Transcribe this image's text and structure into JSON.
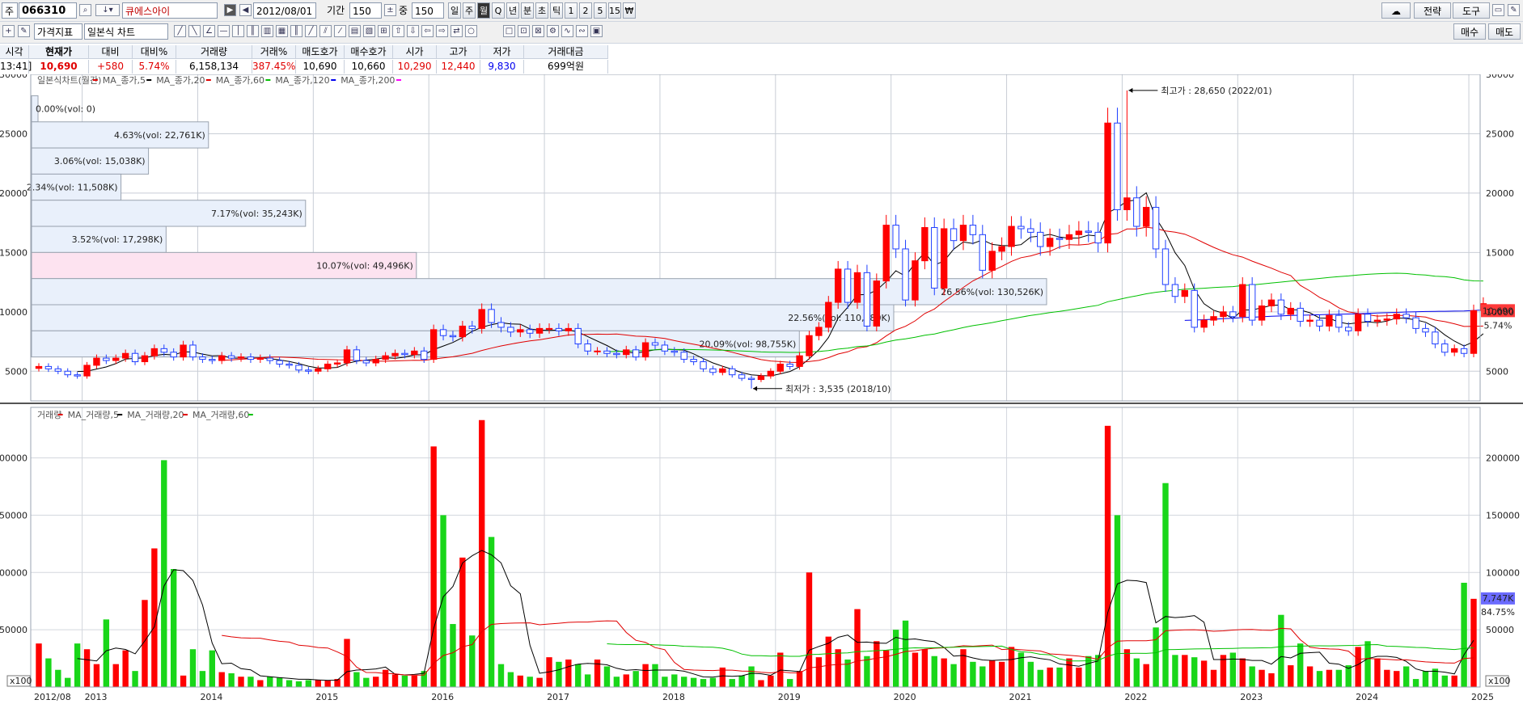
{
  "toolbar1": {
    "market_label": "주",
    "code": "066310",
    "name": "큐에스아이",
    "date": "2012/08/01",
    "period_label": "기간",
    "period_value": "150",
    "count_label": "중",
    "count_value": "150",
    "period_buttons": [
      "일",
      "주",
      "월",
      "Q",
      "년",
      "분",
      "초",
      "틱",
      "1",
      "2",
      "5",
      "15",
      "₩"
    ],
    "strategy_label": "전략",
    "tools_label": "도구"
  },
  "toolbar2": {
    "indicator_label": "가격지표",
    "chart_type": "일본식 차트",
    "buy_label": "매수",
    "sell_label": "매도"
  },
  "quote": {
    "headers": [
      "시각",
      "현재가",
      "대비",
      "대비%",
      "거래량",
      "거래%",
      "매도호가",
      "매수호가",
      "시가",
      "고가",
      "저가",
      "거래대금"
    ],
    "values": [
      "13:41]",
      "10,690",
      "+580",
      "5.74%",
      "6,158,134",
      "387.45%",
      "10,690",
      "10,660",
      "10,290",
      "12,440",
      "9,830",
      "699억원"
    ]
  },
  "chart_data": [
    {
      "type": "candlestick",
      "legend": [
        "일본식차트(월간)",
        "MA_종가,5",
        "MA_종가,20",
        "MA_종가,60",
        "MA_종가,120",
        "MA_종가,200"
      ],
      "legend_colors": [
        "#e00000",
        "#e00000",
        "#000000",
        "#e00000",
        "#00c000",
        "#0000ee",
        "#ff00ff"
      ],
      "y_ticks": [
        5000,
        10000,
        15000,
        20000,
        25000,
        30000
      ],
      "ylim": [
        2500,
        30000
      ],
      "x_tick_labels": [
        "2012/08",
        "2013",
        "2014",
        "2015",
        "2016",
        "2017",
        "2018",
        "2019",
        "2020",
        "2021",
        "2022",
        "2023",
        "2024",
        "2025"
      ],
      "x_tick_dates": [
        "2012-08",
        "2013-01",
        "2014-01",
        "2015-01",
        "2016-01",
        "2017-01",
        "2018-01",
        "2019-01",
        "2020-01",
        "2021-01",
        "2022-01",
        "2023-01",
        "2024-01",
        "2025-01"
      ],
      "months": [
        "2012-08",
        "2012-09",
        "2012-10",
        "2012-11",
        "2012-12",
        "2013-01",
        "2013-02",
        "2013-03",
        "2013-04",
        "2013-05",
        "2013-06",
        "2013-07",
        "2013-08",
        "2013-09",
        "2013-10",
        "2013-11",
        "2013-12",
        "2014-01",
        "2014-02",
        "2014-03",
        "2014-04",
        "2014-05",
        "2014-06",
        "2014-07",
        "2014-08",
        "2014-09",
        "2014-10",
        "2014-11",
        "2014-12",
        "2015-01",
        "2015-02",
        "2015-03",
        "2015-04",
        "2015-05",
        "2015-06",
        "2015-07",
        "2015-08",
        "2015-09",
        "2015-10",
        "2015-11",
        "2015-12",
        "2016-01",
        "2016-02",
        "2016-03",
        "2016-04",
        "2016-05",
        "2016-06",
        "2016-07",
        "2016-08",
        "2016-09",
        "2016-10",
        "2016-11",
        "2016-12",
        "2017-01",
        "2017-02",
        "2017-03",
        "2017-04",
        "2017-05",
        "2017-06",
        "2017-07",
        "2017-08",
        "2017-09",
        "2017-10",
        "2017-11",
        "2017-12",
        "2018-01",
        "2018-02",
        "2018-03",
        "2018-04",
        "2018-05",
        "2018-06",
        "2018-07",
        "2018-08",
        "2018-09",
        "2018-10",
        "2018-11",
        "2018-12",
        "2019-01",
        "2019-02",
        "2019-03",
        "2019-04",
        "2019-05",
        "2019-06",
        "2019-07",
        "2019-08",
        "2019-09",
        "2019-10",
        "2019-11",
        "2019-12",
        "2020-01",
        "2020-02",
        "2020-03",
        "2020-04",
        "2020-05",
        "2020-06",
        "2020-07",
        "2020-08",
        "2020-09",
        "2020-10",
        "2020-11",
        "2020-12",
        "2021-01",
        "2021-02",
        "2021-03",
        "2021-04",
        "2021-05",
        "2021-06",
        "2021-07",
        "2021-08",
        "2021-09",
        "2021-10",
        "2021-11",
        "2021-12",
        "2022-01",
        "2022-02",
        "2022-03",
        "2022-04",
        "2022-05",
        "2022-06",
        "2022-07",
        "2022-08",
        "2022-09",
        "2022-10",
        "2022-11",
        "2022-12",
        "2023-01",
        "2023-02",
        "2023-03",
        "2023-04",
        "2023-05",
        "2023-06",
        "2023-07",
        "2023-08",
        "2023-09",
        "2023-10",
        "2023-11",
        "2023-12",
        "2024-01",
        "2024-02",
        "2024-03",
        "2024-04",
        "2024-05",
        "2024-06",
        "2024-07",
        "2024-08",
        "2024-09",
        "2024-10",
        "2024-11",
        "2024-12",
        "2025-01"
      ],
      "close": [
        5400,
        5200,
        5000,
        4700,
        4600,
        5500,
        6100,
        5900,
        6100,
        6500,
        5800,
        6300,
        6900,
        6600,
        6200,
        7200,
        6200,
        6000,
        5900,
        6300,
        6100,
        6200,
        6000,
        6100,
        5900,
        5600,
        5500,
        5100,
        5000,
        5200,
        5600,
        5700,
        6800,
        5900,
        5700,
        6000,
        6300,
        6500,
        6400,
        6700,
        6000,
        8500,
        8000,
        7900,
        8800,
        8600,
        10200,
        9100,
        8700,
        8300,
        8500,
        8200,
        8600,
        8600,
        8400,
        8600,
        7300,
        6700,
        6700,
        6500,
        6400,
        6800,
        6200,
        7400,
        7200,
        6700,
        6600,
        6000,
        5800,
        5200,
        4900,
        5200,
        4700,
        4400,
        4300,
        4600,
        5000,
        5600,
        5400,
        6300,
        8000,
        8700,
        10800,
        13600,
        10800,
        13300,
        8800,
        12600,
        17300,
        15300,
        11000,
        14300,
        17100,
        12000,
        17000,
        16000,
        17300,
        16500,
        13500,
        15100,
        15500,
        17200,
        17000,
        16700,
        15500,
        16200,
        16100,
        16500,
        16800,
        16700,
        15800,
        25900,
        18600,
        19600,
        17200,
        18800,
        15300,
        12300,
        11300,
        11800,
        8700,
        9300,
        9600,
        10000,
        9600,
        12300,
        9300,
        10500,
        11000,
        9800,
        10300,
        9200,
        9300,
        8800,
        9700,
        8700,
        8400,
        9800,
        9200,
        9300,
        9400,
        9800,
        9500,
        8600,
        8300,
        7300,
        6600,
        6900,
        6500,
        10100,
        10690
      ],
      "price_labels": [
        {
          "text": "최고가 : 28,650 (2022/01)",
          "date": "2022-01",
          "price": 28650
        },
        {
          "text": "최저가 : 3,535 (2018/10)",
          "date": "2018-10",
          "price": 3535
        }
      ],
      "volume_profile": [
        {
          "label": "0.00%(vol: 0)",
          "percent": 0.0,
          "from": 26000,
          "to": 28200
        },
        {
          "label": "4.63%(vol: 22,761K)",
          "percent": 4.63,
          "from": 23800,
          "to": 26000
        },
        {
          "label": "3.06%(vol: 15,038K)",
          "percent": 3.06,
          "from": 21600,
          "to": 23800
        },
        {
          "label": "2.34%(vol: 11,508K)",
          "percent": 2.34,
          "from": 19400,
          "to": 21600
        },
        {
          "label": "7.17%(vol: 35,243K)",
          "percent": 7.17,
          "from": 17200,
          "to": 19400
        },
        {
          "label": "3.52%(vol: 17,298K)",
          "percent": 3.52,
          "from": 15000,
          "to": 17200
        },
        {
          "label": "10.07%(vol: 49,496K)",
          "percent": 10.07,
          "from": 12800,
          "to": 15000
        },
        {
          "label": "26.56%(vol: 130,526K)",
          "percent": 26.56,
          "from": 10600,
          "to": 12800
        },
        {
          "label": "22.56%(vol: 110,880K)",
          "percent": 22.56,
          "from": 8400,
          "to": 10600
        },
        {
          "label": "20.09%(vol: 98,755K)",
          "percent": 20.09,
          "from": 6200,
          "to": 8400
        }
      ],
      "current_price_label": "10,690",
      "current_change_label": "5.74%"
    },
    {
      "type": "bar",
      "legend": [
        "거래량",
        "MA_거래량,5",
        "MA_거래량,20",
        "MA_거래량,60"
      ],
      "legend_colors": [
        "#e00000",
        "#e00000",
        "#000000",
        "#e00000",
        "#00c000"
      ],
      "y_ticks": [
        50000,
        100000,
        150000,
        200000
      ],
      "ylim": [
        0,
        230000
      ],
      "unit_label": "x100",
      "volume": [
        38000,
        25000,
        15000,
        8000,
        38000,
        33000,
        20000,
        59000,
        20000,
        32000,
        14000,
        76000,
        121000,
        198000,
        103000,
        10000,
        33000,
        14000,
        32000,
        13000,
        12000,
        9000,
        9000,
        6000,
        9000,
        8000,
        6000,
        5000,
        6000,
        6000,
        6000,
        7000,
        42000,
        13000,
        8000,
        9000,
        15000,
        11000,
        10000,
        10000,
        14000,
        210000,
        150000,
        55000,
        113000,
        45000,
        233000,
        131000,
        20000,
        13000,
        10000,
        9000,
        8000,
        26000,
        22000,
        24000,
        20000,
        11000,
        24000,
        18000,
        9000,
        11000,
        14000,
        20000,
        20000,
        9000,
        11000,
        9000,
        8000,
        7000,
        8000,
        17000,
        7000,
        10000,
        18000,
        6000,
        10000,
        30000,
        7000,
        14000,
        100000,
        26000,
        44000,
        33000,
        24000,
        68000,
        27000,
        40000,
        32000,
        50000,
        58000,
        30000,
        33000,
        27000,
        25000,
        20000,
        33000,
        22000,
        18000,
        23000,
        22000,
        35000,
        30000,
        22000,
        15000,
        17000,
        17000,
        25000,
        17000,
        27000,
        28000,
        228000,
        150000,
        33000,
        25000,
        20000,
        52000,
        178000,
        28000,
        28000,
        26000,
        23000,
        15000,
        28000,
        30000,
        25000,
        18000,
        15000,
        12000,
        63000,
        19000,
        38000,
        18000,
        14000,
        15000,
        15000,
        19000,
        35000,
        40000,
        25000,
        15000,
        14000,
        18000,
        7000,
        14000,
        16000,
        10000,
        10000,
        91000,
        77000
      ],
      "current_volume_label": "7,747K",
      "current_volume_pct_label": "84.75%"
    }
  ]
}
